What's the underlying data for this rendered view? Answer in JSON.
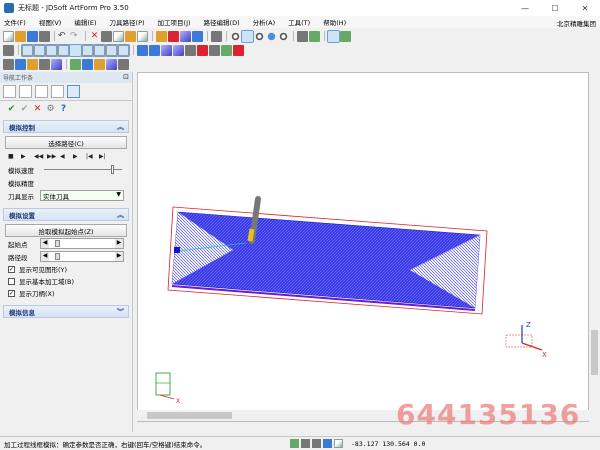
{
  "window": {
    "title": "无标题 - JDSoft ArtForm Pro 3.50"
  },
  "menu": {
    "items": [
      "文件(F)",
      "视图(V)",
      "编辑(E)",
      "刀具路径(P)",
      "加工项目(J)",
      "路径编辑(D)",
      "分析(A)",
      "工具(T)",
      "帮助(H)"
    ],
    "right_text": "北京精雕集团"
  },
  "nav_panel": {
    "title": "导航工作条",
    "actions": {
      "ok": "✔",
      "apply": "✔",
      "cancel": "✕"
    },
    "sim_control": {
      "header": "模拟控制",
      "select_path_button": "选择路径(C)",
      "play_buttons": [
        "■",
        "▶",
        "◀◀",
        "▶▶",
        "◀",
        "▶",
        "|◀",
        "▶|"
      ],
      "speed_label": "模拟速度",
      "precision_label": "模拟精度",
      "tool_display_label": "刀具显示",
      "tool_display_value": "实体刀具"
    },
    "sim_settings": {
      "header": "模拟设置",
      "pick_start_button": "拾取模拟起始点(Z)",
      "start_label": "起始点",
      "path_segment_label": "路径段",
      "checkboxes": [
        {
          "label": "显示可见图形(Y)",
          "checked": true
        },
        {
          "label": "显示基本加工域(B)",
          "checked": false
        },
        {
          "label": "显示刀柄(X)",
          "checked": true
        }
      ]
    },
    "sim_info": {
      "header": "模拟信息"
    }
  },
  "viewport": {
    "axis_labels": {
      "z": "Z",
      "x": "X"
    }
  },
  "watermark": "644135136",
  "status": {
    "message": "加工过程线框模拟：确定参数是否正确，右键(回车/空格键)结束命令。",
    "coords": "-83.127  130.564  0.0"
  },
  "colors": {
    "mesh": "#3a3ae8",
    "boundary": "#e02020",
    "tool": "#8a8a8a"
  }
}
